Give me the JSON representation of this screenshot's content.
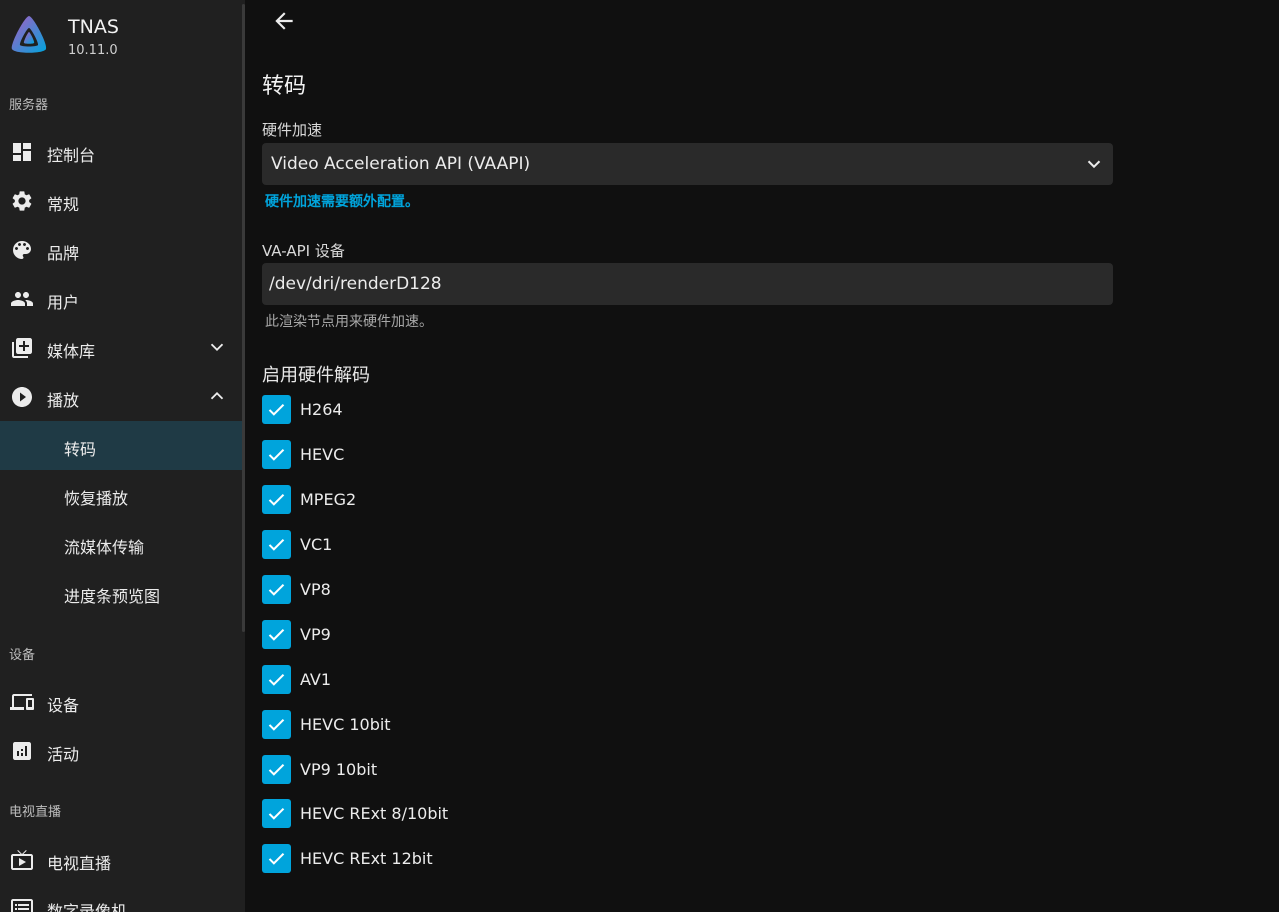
{
  "app": {
    "name": "TNAS",
    "version": "10.11.0"
  },
  "colors": {
    "accent": "#00a4dc",
    "sidebar_bg": "#202020",
    "main_bg": "#101010",
    "active_item": "#1f3a45"
  },
  "sidebar": {
    "server_section": "服务器",
    "items": [
      {
        "label": "控制台",
        "icon": "dashboard-icon"
      },
      {
        "label": "常规",
        "icon": "gear-icon"
      },
      {
        "label": "品牌",
        "icon": "palette-icon"
      },
      {
        "label": "用户",
        "icon": "people-icon"
      },
      {
        "label": "媒体库",
        "icon": "library-add-icon",
        "expanded": false
      },
      {
        "label": "播放",
        "icon": "play-circle-icon",
        "expanded": true
      }
    ],
    "playback_sub": [
      {
        "label": "转码",
        "active": true
      },
      {
        "label": "恢复播放",
        "active": false
      },
      {
        "label": "流媒体传输",
        "active": false
      },
      {
        "label": "进度条预览图",
        "active": false
      }
    ],
    "devices_section": "设备",
    "device_items": [
      {
        "label": "设备",
        "icon": "devices-icon"
      },
      {
        "label": "活动",
        "icon": "analytics-icon"
      }
    ],
    "livetv_section": "电视直播",
    "livetv_items": [
      {
        "label": "电视直播",
        "icon": "live-tv-icon"
      },
      {
        "label": "数字录像机",
        "icon": "dvr-icon"
      }
    ]
  },
  "main": {
    "title": "转码",
    "hw_accel": {
      "label": "硬件加速",
      "value": "Video Acceleration API (VAAPI)",
      "help_link": "硬件加速需要额外配置。"
    },
    "vaapi_device": {
      "label": "VA-API 设备",
      "value": "/dev/dri/renderD128",
      "help": "此渲染节点用来硬件加速。"
    },
    "hw_decode": {
      "heading": "启用硬件解码",
      "codecs": [
        {
          "label": "H264",
          "checked": true
        },
        {
          "label": "HEVC",
          "checked": true
        },
        {
          "label": "MPEG2",
          "checked": true
        },
        {
          "label": "VC1",
          "checked": true
        },
        {
          "label": "VP8",
          "checked": true
        },
        {
          "label": "VP9",
          "checked": true
        },
        {
          "label": "AV1",
          "checked": true
        },
        {
          "label": "HEVC 10bit",
          "checked": true
        },
        {
          "label": "VP9 10bit",
          "checked": true
        },
        {
          "label": "HEVC RExt 8/10bit",
          "checked": true
        },
        {
          "label": "HEVC RExt 12bit",
          "checked": true
        }
      ]
    }
  }
}
